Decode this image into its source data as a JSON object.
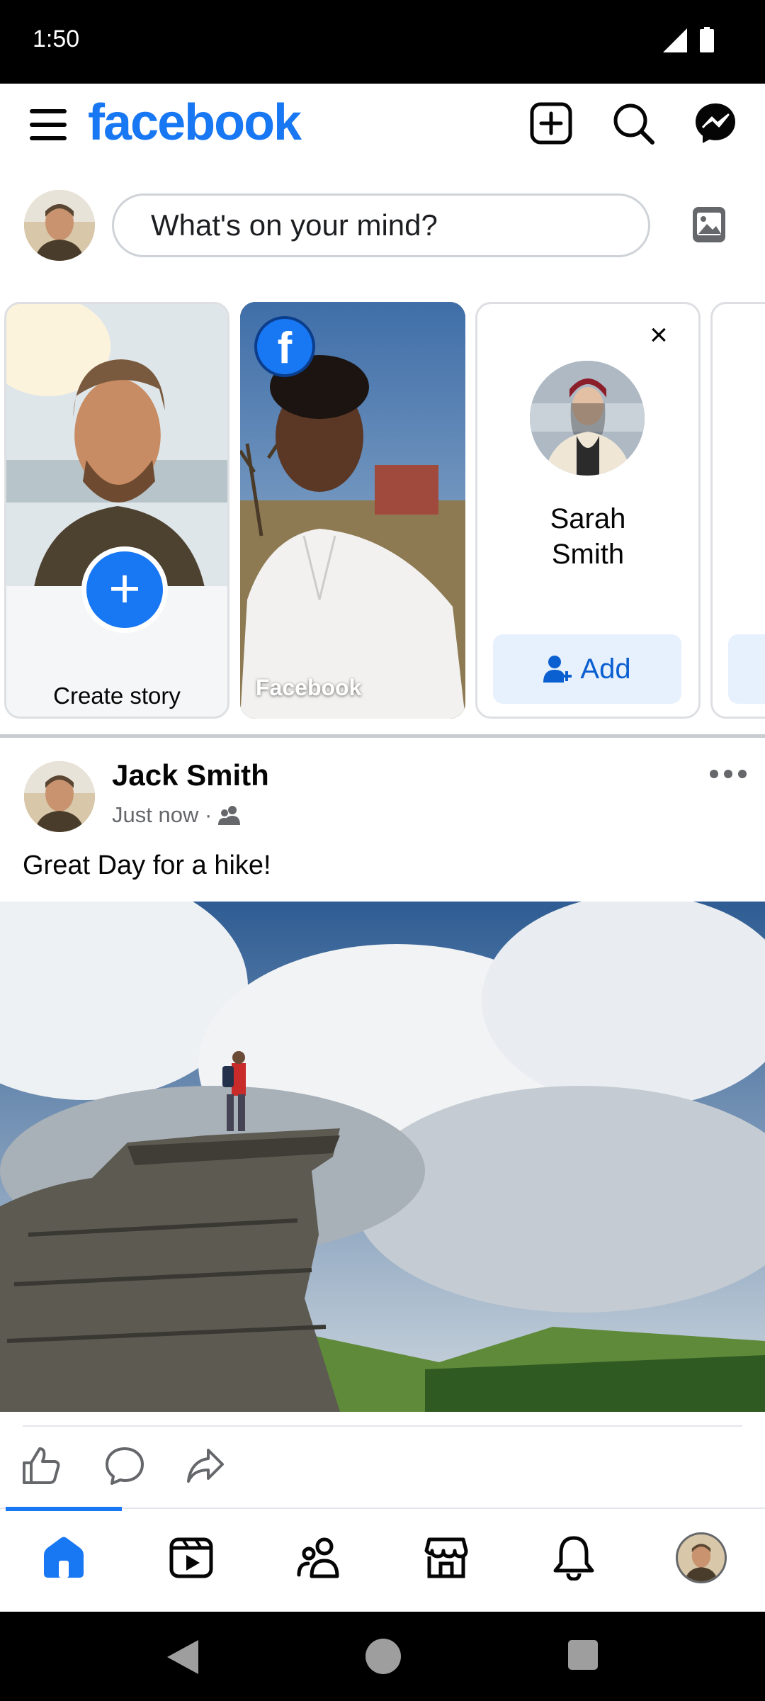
{
  "status_bar": {
    "time": "1:50"
  },
  "header": {
    "logo": "facebook"
  },
  "composer": {
    "placeholder": "What's on your mind?"
  },
  "stories": {
    "create_label": "Create story",
    "create_plus": "+",
    "fb_badge": "f",
    "fb_label": "Facebook",
    "suggestion": {
      "name_line1": "Sarah",
      "name_line2": "Smith",
      "add_label": "Add",
      "close": "×"
    }
  },
  "post": {
    "author": "Jack Smith",
    "time": "Just now",
    "separator": "·",
    "text": "Great Day for a hike!"
  },
  "colors": {
    "brand": "#1877f2",
    "add_bg": "#e7f0fd"
  },
  "icons": {
    "menu": "hamburger-icon",
    "create": "plus-square-icon",
    "search": "search-icon",
    "messenger": "messenger-icon",
    "photo": "photo-icon",
    "like": "thumbs-up-icon",
    "comment": "comment-icon",
    "share": "share-icon",
    "audience": "friends-icon",
    "more": "more-dots-icon",
    "nav": [
      "home-icon",
      "video-icon",
      "friends-icon",
      "marketplace-icon",
      "bell-icon",
      "profile-avatar"
    ]
  },
  "bottom_nav": {
    "active": "home"
  }
}
